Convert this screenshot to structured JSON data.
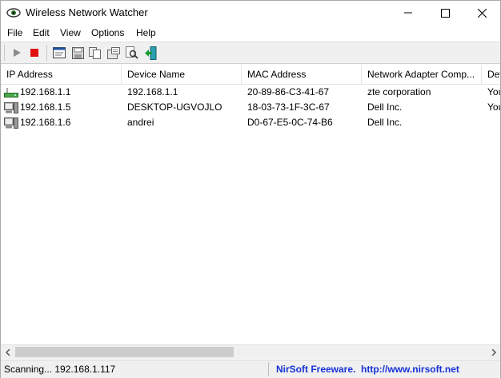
{
  "window": {
    "title": "Wireless Network Watcher",
    "icon": "network-eye-icon"
  },
  "menu": [
    "File",
    "Edit",
    "View",
    "Options",
    "Help"
  ],
  "toolbar_icons": [
    "play-icon",
    "stop-icon",
    "html-report-icon",
    "save-icon",
    "copy-icon",
    "properties-icon",
    "find-icon",
    "exit-icon"
  ],
  "columns": [
    "IP Address",
    "Device Name",
    "MAC Address",
    "Network Adapter Comp...",
    "Dev"
  ],
  "rows": [
    {
      "icon": "router-icon",
      "ip": "192.168.1.1",
      "device": "192.168.1.1",
      "mac": "20-89-86-C3-41-67",
      "vendor": "zte corporation",
      "info": "You"
    },
    {
      "icon": "computer-icon",
      "ip": "192.168.1.5",
      "device": "DESKTOP-UGVOJLO",
      "mac": "18-03-73-1F-3C-67",
      "vendor": "Dell Inc.",
      "info": "You"
    },
    {
      "icon": "computer-icon",
      "ip": "192.168.1.6",
      "device": "andrei",
      "mac": "D0-67-E5-0C-74-B6",
      "vendor": "Dell Inc.",
      "info": ""
    }
  ],
  "status": {
    "left": "Scanning... 192.168.1.117",
    "right": "NirSoft Freeware.  http://www.nirsoft.net"
  }
}
